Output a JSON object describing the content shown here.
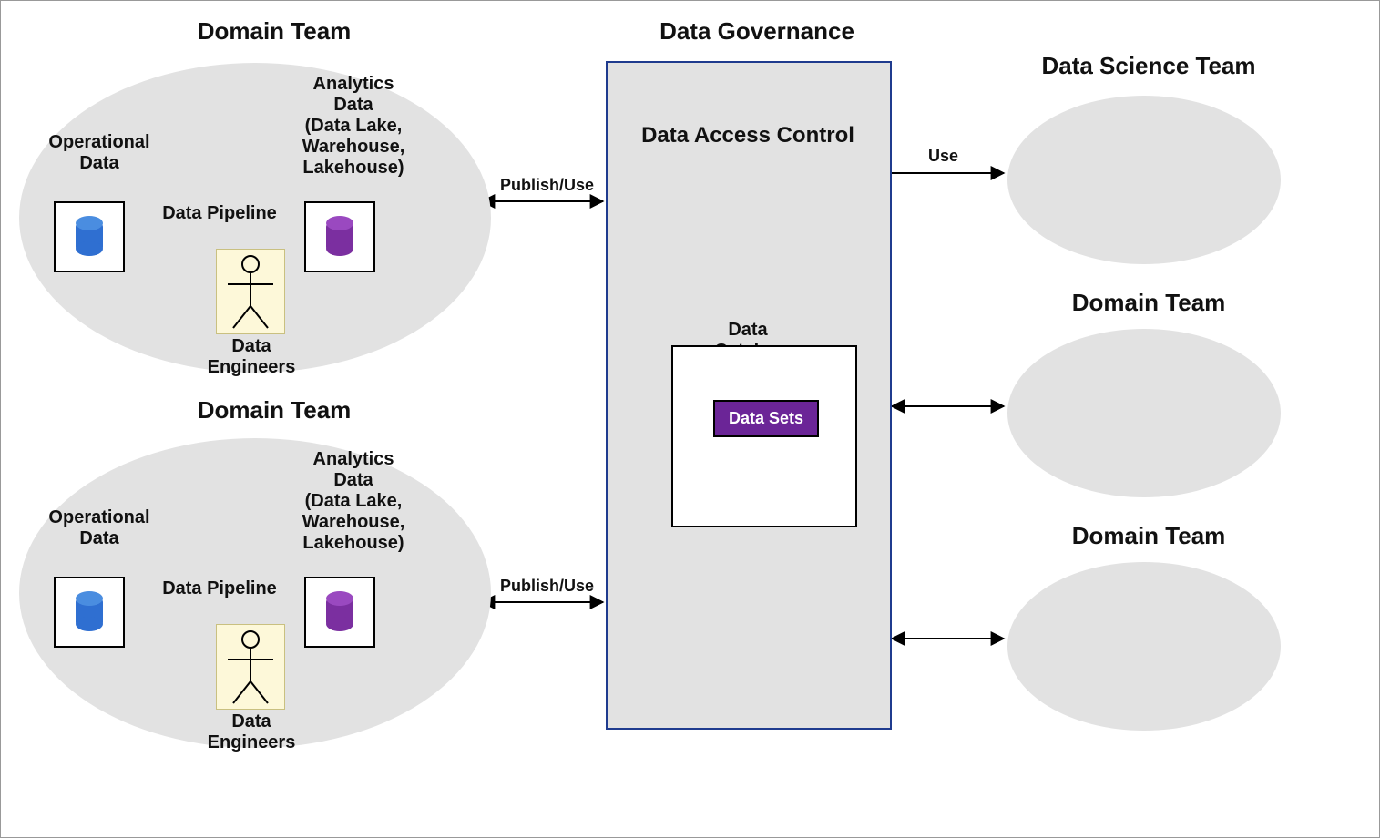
{
  "headings": {
    "domain_team": "Domain Team",
    "data_governance": "Data Governance",
    "data_science_team": "Data Science Team"
  },
  "labels": {
    "operational_data": "Operational\nData",
    "analytics_data": "Analytics\nData\n(Data Lake,\nWarehouse,\nLakehouse)",
    "data_pipeline": "Data Pipeline",
    "data_engineers": "Data\nEngineers",
    "data_access_control": "Data Access Control",
    "data_catalog": "Data Catalog",
    "data_sets": "Data Sets",
    "publish_use": "Publish/Use",
    "use": "Use"
  },
  "colors": {
    "ellipse_fill": "#e2e2e2",
    "gov_border": "#1f3b8e",
    "db_blue": "#2f6fd1",
    "db_purple": "#7b2fa0",
    "datasets_fill": "#6b2597"
  }
}
